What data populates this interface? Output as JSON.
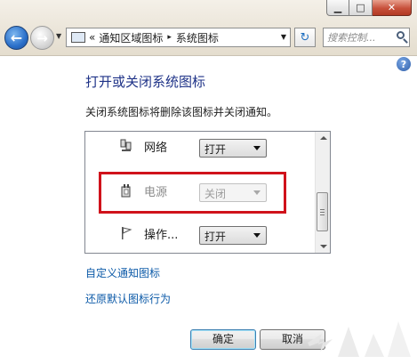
{
  "window": {
    "minimize_glyph": "▁",
    "maximize_glyph": "□",
    "close_glyph": "✕"
  },
  "address_bar": {
    "overflow": "«",
    "segments": [
      "通知区域图标",
      "系统图标"
    ],
    "separator": "▸"
  },
  "search": {
    "placeholder": "搜索控制..."
  },
  "content": {
    "title": "打开或关闭系统图标",
    "description": "关闭系统图标将删除该图标并关闭通知。",
    "icon_rows": [
      {
        "name": "网络",
        "icon": "network-icon",
        "state": "打开",
        "enabled": true
      },
      {
        "name": "电源",
        "icon": "power-icon",
        "state": "关闭",
        "enabled": false
      },
      {
        "name": "操作...",
        "icon": "action-center-flag-icon",
        "state": "打开",
        "enabled": true
      }
    ],
    "links": [
      "自定义通知图标",
      "还原默认图标行为"
    ]
  },
  "buttons": {
    "ok": "确定",
    "cancel": "取消"
  },
  "colors": {
    "title": "#1e3287",
    "link": "#0c5aa8",
    "highlight": "#d0121b"
  }
}
